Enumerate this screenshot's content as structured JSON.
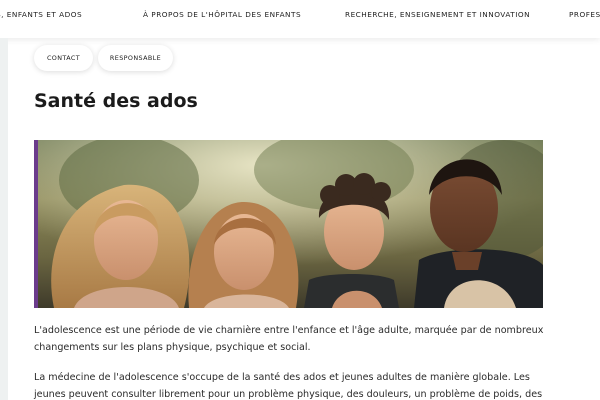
{
  "nav": {
    "items": [
      "S, ENFANTS ET ADOS",
      "À PROPOS DE L'HÔPITAL DES ENFANTS",
      "RECHERCHE, ENSEIGNEMENT ET INNOVATION",
      "PROFESS"
    ]
  },
  "actions": {
    "contact": "CONTACT",
    "responsable": "RESPONSABLE"
  },
  "page": {
    "title": "Santé des ados"
  },
  "content": {
    "paragraphs": [
      "L'adolescence est une période de vie charnière entre l'enfance et l'âge adulte, marquée par de nombreux changements sur les plans physique, psychique et social.",
      "La médecine de l'adolescence s'occupe de la santé des ados et jeunes adultes de manière globale. Les jeunes peuvent consulter librement pour un problème physique, des douleurs, un problème de poids, des symptômes"
    ]
  },
  "colors": {
    "accent": "#6b3b8c"
  }
}
